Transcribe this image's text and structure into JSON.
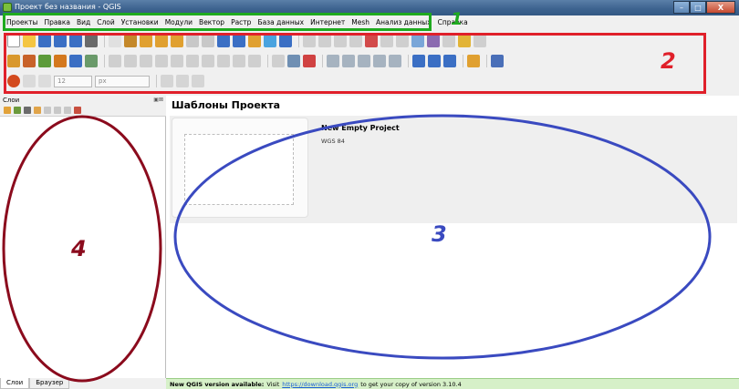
{
  "window": {
    "title": "Проект без названия - QGIS",
    "min_glyph": "–",
    "max_glyph": "□",
    "close_glyph": "X"
  },
  "menu": [
    {
      "label": "Проекты"
    },
    {
      "label": "Правка"
    },
    {
      "label": "Вид"
    },
    {
      "label": "Слой"
    },
    {
      "label": "Установки"
    },
    {
      "label": "Модули"
    },
    {
      "label": "Вектор"
    },
    {
      "label": "Растр"
    },
    {
      "label": "База данных"
    },
    {
      "label": "Интернет"
    },
    {
      "label": "Mesh"
    },
    {
      "label": "Анализ данных"
    },
    {
      "label": "Справка"
    }
  ],
  "toolbar": {
    "font_size_value": "12",
    "unit_value": "px"
  },
  "annotations": {
    "label_1": "1",
    "label_2": "2",
    "label_3": "3",
    "label_4": "4",
    "color_menu": "#1faa1f",
    "color_toolbar": "#e0202a",
    "color_main": "#3a4ac0",
    "color_layers": "#8b0b1d"
  },
  "layers_panel": {
    "title": "Слои",
    "header_buttons": "▣⊠"
  },
  "tabs": [
    {
      "label": "Слои"
    },
    {
      "label": "Браузер"
    }
  ],
  "main": {
    "title": "Шаблоны Проекта",
    "template_name": "New Empty Project",
    "template_crs": "WGS 84"
  },
  "status": {
    "lead": "New QGIS version available:",
    "text1": "Visit",
    "link": "https://download.qgis.org",
    "text2": "to get your copy of version 3.10.4"
  }
}
